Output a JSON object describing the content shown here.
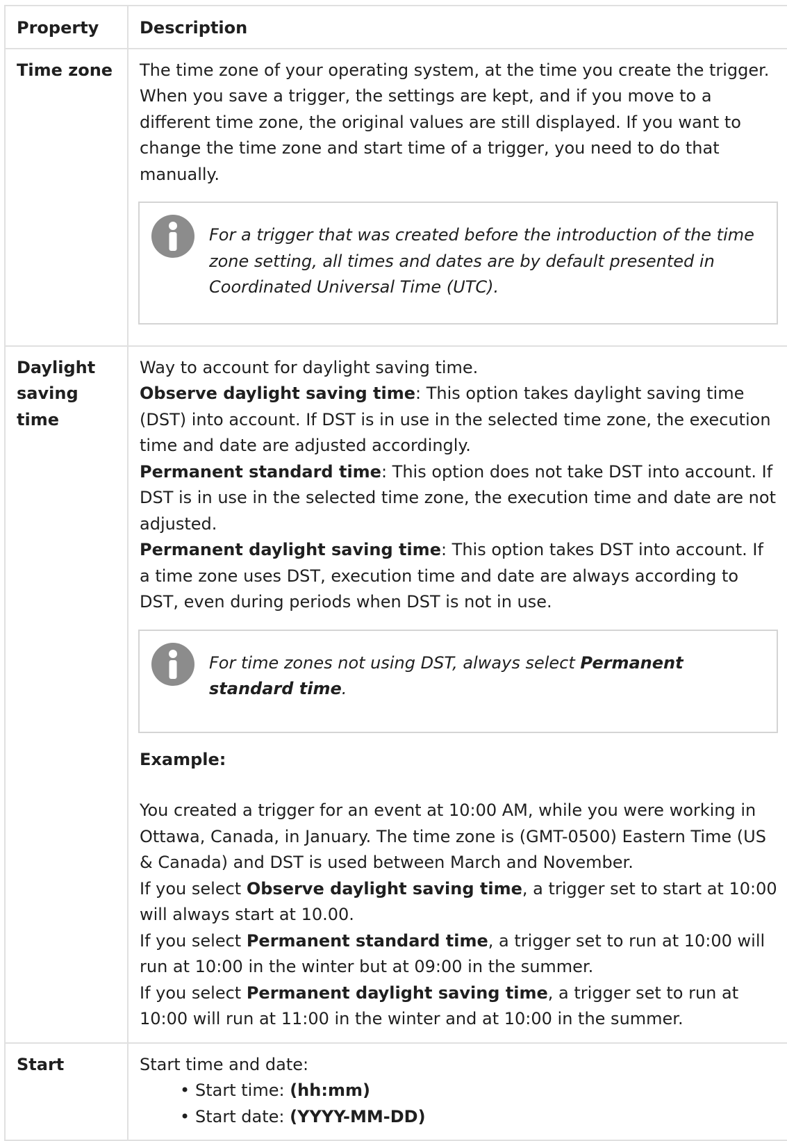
{
  "table": {
    "header": {
      "property": "Property",
      "description": "Description"
    },
    "time_zone": {
      "name": "Time zone",
      "text": "The time zone of your operating system, at the time you create the trigger. When you save a trigger, the settings are kept, and if you move to a different time zone, the original values are still displayed. If you want to change the time zone and start time of a trigger, you need to do that manually.",
      "note": {
        "icon": "info-icon",
        "text": "For a trigger that was created before the introduction of the time zone setting, all times and dates are by default presented in Coordinated Universal Time (UTC)."
      }
    },
    "dst": {
      "name": "Daylight saving time",
      "intro": "Way to account for daylight saving time.",
      "options": [
        {
          "label": "Observe daylight saving time",
          "text": ": This option takes daylight saving time (DST) into account. If DST is in use in the selected time zone, the execution time and date are adjusted accordingly."
        },
        {
          "label": "Permanent standard time",
          "text": ": This option does not take DST into account. If DST is in use in the selected time zone, the execution time and date are not adjusted."
        },
        {
          "label": "Permanent daylight saving time",
          "text": ": This option takes DST into account. If a time zone uses DST, execution time and date are always according to DST, even during periods when DST is not in use."
        }
      ],
      "note": {
        "icon": "info-icon",
        "prefix": "For time zones not using DST, always select ",
        "bold": "Permanent standard time",
        "suffix": "."
      },
      "example_heading": "Example:",
      "example_intro": "You created a trigger for an event at 10:00 AM, while you were working in Ottawa, Canada, in January. The time zone is (GMT-0500) Eastern Time (US & Canada) and DST is used between March and November.",
      "example_lines": [
        {
          "prefix": "If you select ",
          "bold": "Observe daylight saving time",
          "suffix": ", a trigger set to start at 10:00 will always start at 10.00."
        },
        {
          "prefix": "If you select ",
          "bold": "Permanent standard time",
          "suffix": ", a trigger set to run at 10:00 will run at 10:00 in the winter but at 09:00 in the summer."
        },
        {
          "prefix": "If you select ",
          "bold": "Permanent daylight saving time",
          "suffix": ", a trigger set to run at 10:00 will run at 11:00 in the winter and at 10:00 in the summer."
        }
      ]
    },
    "start": {
      "name": "Start",
      "intro": "Start time and date:",
      "items": [
        {
          "label": "Start time: ",
          "format": "(hh:mm)"
        },
        {
          "label": "Start date: ",
          "format": "(YYYY-MM-DD)"
        }
      ]
    }
  }
}
